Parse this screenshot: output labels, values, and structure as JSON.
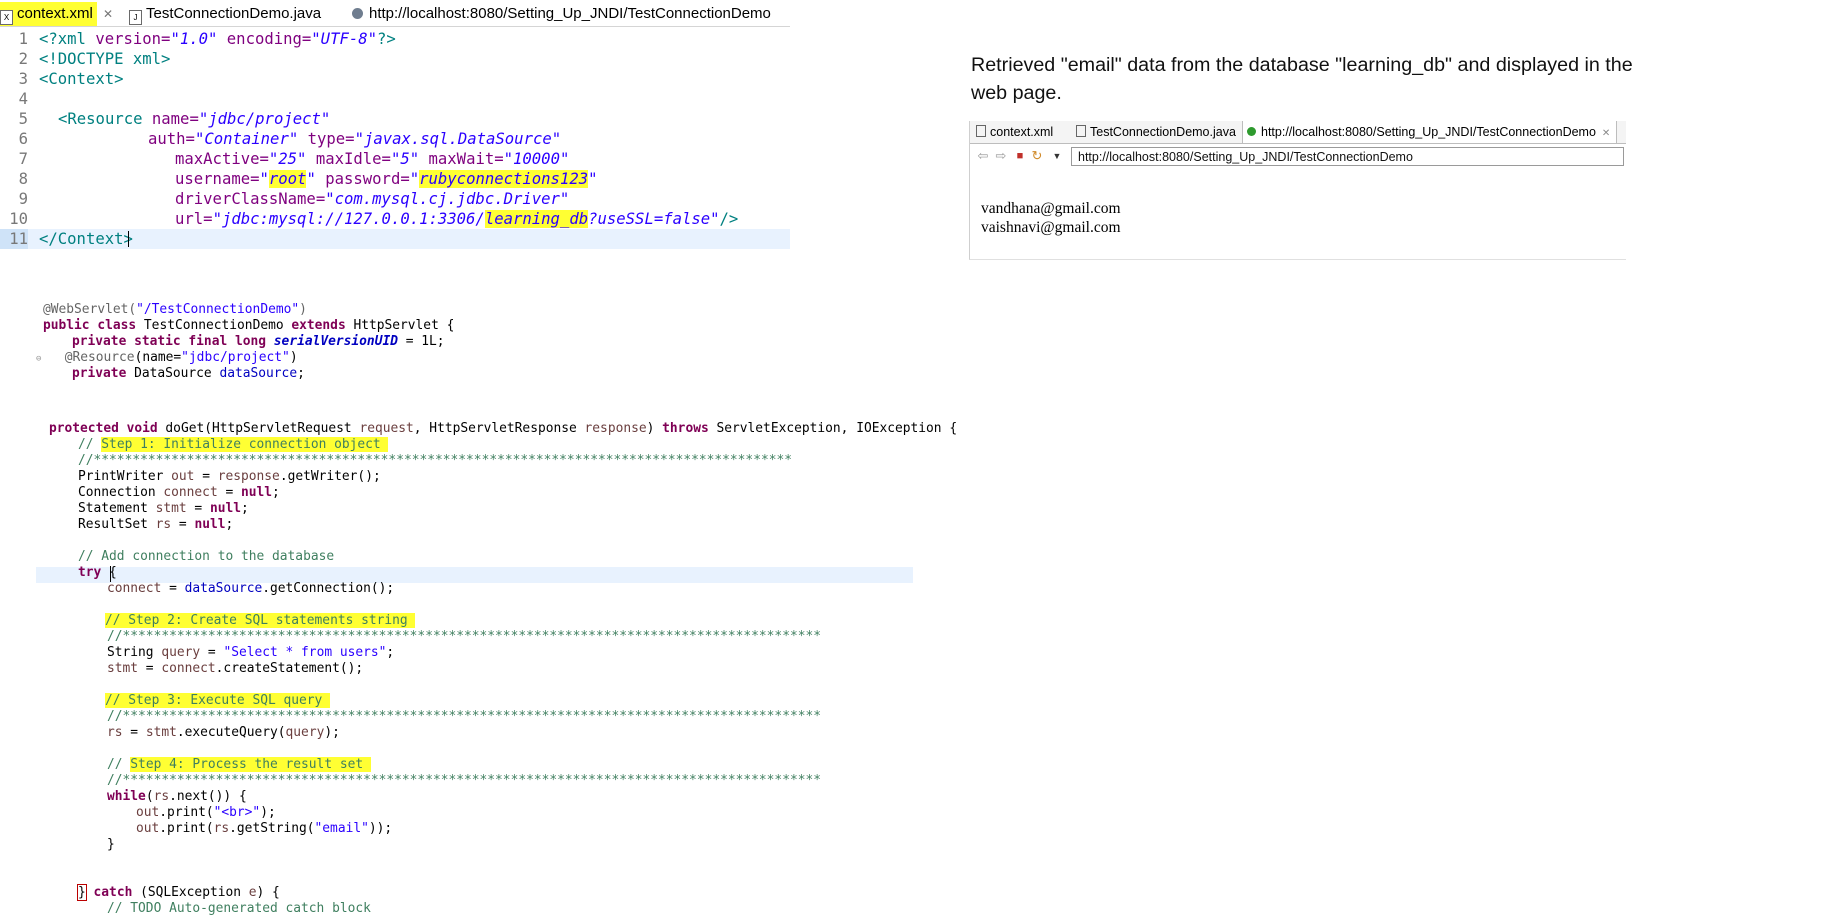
{
  "editor_tabs": [
    {
      "label": "context.xml",
      "close": "✕"
    },
    {
      "label": "TestConnectionDemo.java"
    },
    {
      "label": "http://localhost:8080/Setting_Up_JNDI/TestConnectionDemo"
    }
  ],
  "xml": {
    "line_numbers": [
      "1",
      "2",
      "3",
      "4",
      "5",
      "6",
      "7",
      "8",
      "9",
      "10",
      "11"
    ],
    "decl": {
      "open": "<?xml ",
      "version_attr": "version=",
      "version_val": "\"1.0\"",
      "encoding_attr": " encoding=",
      "encoding_val": "\"UTF-8\"",
      "close": "?>"
    },
    "doctype": "<!DOCTYPE xml>",
    "context_open": "<Context>",
    "resource": {
      "tag": "<Resource ",
      "name_attr": "name=",
      "name_val": "\"jdbc/project\"",
      "auth_attr": "auth=",
      "auth_val": "\"Container\"",
      "type_attr": " type=",
      "type_val": "\"javax.sql.DataSource\"",
      "maxactive_attr": "maxActive=",
      "maxactive_val": "\"25\"",
      "maxidle_attr": " maxIdle=",
      "maxidle_val": "\"5\"",
      "maxwait_attr": " maxWait=",
      "maxwait_val": "\"10000\"",
      "username_attr": "username=",
      "username_q1": "\"",
      "username_val": "root",
      "username_q2": "\"",
      "password_attr": " password=",
      "password_q1": "\"",
      "password_val": "rubyconnections123",
      "password_q2": "\"",
      "driver_attr": "driverClassName=",
      "driver_val": "\"com.mysql.cj.jdbc.Driver\"",
      "url_attr": "url=",
      "url_pre": "\"jdbc:mysql://127.0.0.1:3306/",
      "url_db": "learning_db",
      "url_post": "?useSSL=false\"",
      "end": "/>"
    },
    "context_close": "</Context>"
  },
  "java": {
    "l1": {
      "ann": "@WebServlet(",
      "str": "\"/TestConnectionDemo\"",
      "end": ")"
    },
    "l2": {
      "kw1": "public",
      "kw2": "class",
      "name": " TestConnectionDemo ",
      "kw3": "extends",
      "rest": " HttpServlet {"
    },
    "l3": {
      "kw": "private static final long",
      "field": "serialVersionUID",
      "rest": " = 1L;"
    },
    "l4": {
      "ann": "@Resource",
      "pre": "(name=",
      "str": "\"jdbc/project\"",
      "end": ")"
    },
    "l5": {
      "kw": "private",
      "type": " DataSource ",
      "field": "dataSource",
      "end": ";"
    },
    "l6": {
      "kw1": "protected void",
      "sig": " doGet(HttpServletRequest ",
      "p1": "request",
      "sig2": ", HttpServletResponse ",
      "p2": "response",
      "sig3": ") ",
      "kw2": "throws",
      "rest": " ServletException, IOException {"
    },
    "step1": {
      "pre": "// ",
      "hl": "Step 1: Initialize connection object "
    },
    "stars": "//******************************************************************************************",
    "stars2": "//******************************************************************************************",
    "l8": {
      "pre": "PrintWriter ",
      "var": "out",
      "mid": " = ",
      "var2": "response",
      "rest": ".getWriter();"
    },
    "l9": {
      "pre": "Connection ",
      "var": "connect",
      "mid": " = ",
      "kw": "null",
      "end": ";"
    },
    "l10": {
      "pre": "Statement ",
      "var": "stmt",
      "mid": " = ",
      "kw": "null",
      "end": ";"
    },
    "l11": {
      "pre": "ResultSet ",
      "var": "rs",
      "mid": " = ",
      "kw": "null",
      "end": ";"
    },
    "c_add": "// Add connection to the database",
    "l_try": {
      "kw": "try",
      "rest": " {"
    },
    "l_conn": {
      "var": "connect",
      "mid": " = ",
      "fld": "dataSource",
      "rest": ".getConnection();"
    },
    "step2": {
      "hl": "// Step 2: Create SQL statements string "
    },
    "l_query": {
      "pre": "String ",
      "var": "query",
      "mid": " = ",
      "str": "\"Select * from users\"",
      "end": ";"
    },
    "l_stmt": {
      "var": "stmt",
      "mid": " = ",
      "var2": "connect",
      "rest": ".createStatement();"
    },
    "step3": {
      "hl": "// Step 3: Execute SQL query "
    },
    "l_rs": {
      "var": "rs",
      "mid": " = ",
      "var2": "stmt",
      "rest": ".executeQuery(",
      "var3": "query",
      "end": ");"
    },
    "step4": {
      "pre": "// ",
      "hl": "Step 4: Process the result set "
    },
    "l_while": {
      "kw": "while",
      "pre": "(",
      "var": "rs",
      "rest": ".next()) {"
    },
    "l_print1": {
      "var": "out",
      "rest": ".print(",
      "str": "\"<br>\"",
      "end": ");"
    },
    "l_print2": {
      "var": "out",
      "rest": ".print(",
      "var2": "rs",
      "rest2": ".getString(",
      "str": "\"email\"",
      "end": "));"
    },
    "l_close": "}",
    "l_catch": {
      "brace": "}",
      "kw": "catch",
      "rest": " (SQLException ",
      "var": "e",
      "end": ") {"
    },
    "l_todo": "// TODO Auto-generated catch block"
  },
  "note": "Retrieved \"email\" data from the database \"learning_db\" and displayed in the web page.",
  "browser": {
    "tabs": [
      {
        "label": "context.xml"
      },
      {
        "label": "TestConnectionDemo.java"
      },
      {
        "label": "http://localhost:8080/Setting_Up_JNDI/TestConnectionDemo",
        "close": "✕"
      }
    ],
    "url": "http://localhost:8080/Setting_Up_JNDI/TestConnectionDemo",
    "results": [
      "vandhana@gmail.com",
      "vaishnavi@gmail.com"
    ]
  },
  "colors": {
    "highlight": "#ffff33",
    "current_line": "#e8f2fe",
    "keyword": "#7f0055",
    "string": "#2a00ff",
    "comment": "#3f7f5f"
  }
}
